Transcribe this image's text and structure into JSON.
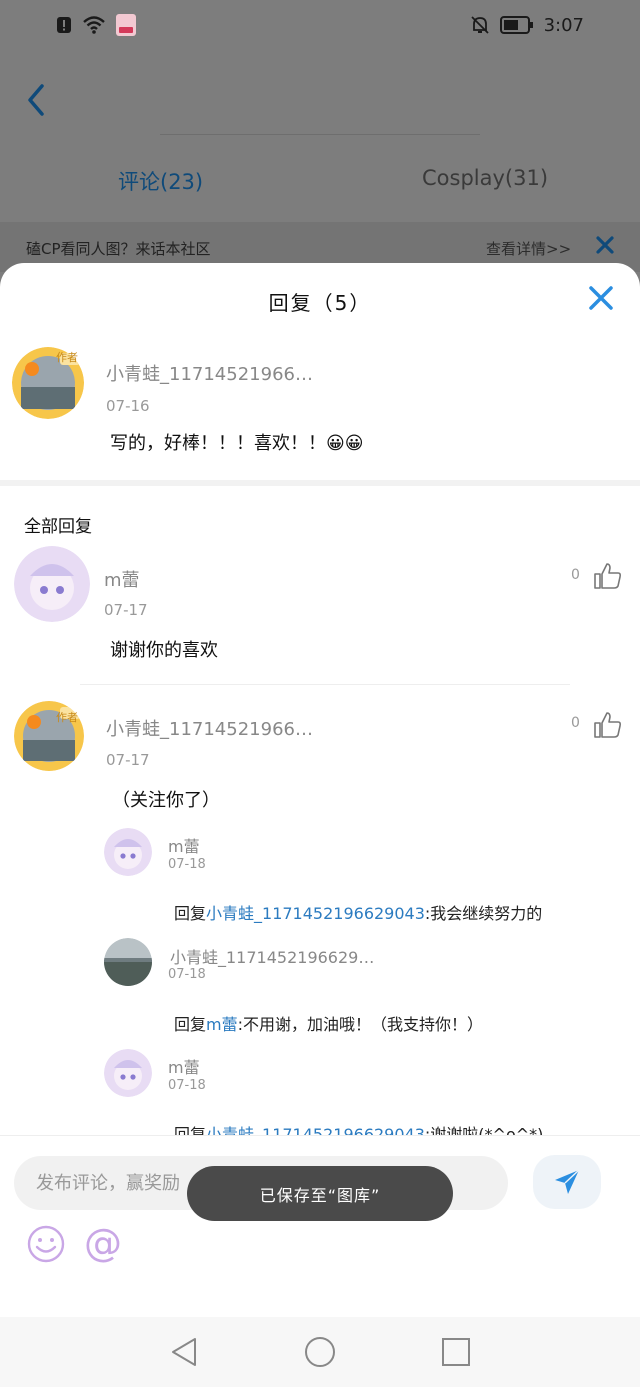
{
  "status_bar": {
    "time": "3:07",
    "icons": [
      "alert-icon",
      "wifi-icon",
      "app-badge-icon",
      "mute-icon",
      "battery-icon"
    ]
  },
  "background_page": {
    "tabs": [
      {
        "label": "评论(23)",
        "active": true
      },
      {
        "label": "Cosplay(31)",
        "active": false
      }
    ],
    "banner": {
      "text": "磕CP看同人图？来话本社区",
      "link": "查看详情>>"
    }
  },
  "sheet": {
    "title": "回复（5）",
    "root_comment": {
      "user": "小青蛙_11714521966…",
      "badge": "作者",
      "date": "07-16",
      "text": "写的，好棒！！！喜欢！！😀😀"
    },
    "section_title": "全部回复",
    "replies": [
      {
        "user": "m蕾",
        "date": "07-17",
        "text": "谢谢你的喜欢",
        "likes": "0"
      },
      {
        "user": "小青蛙_11714521966…",
        "badge": "作者",
        "date": "07-17",
        "text": "（关注你了）",
        "likes": "0",
        "sub_replies": [
          {
            "user": "m蕾",
            "date": "07-18",
            "prefix": "回复",
            "target": "小青蛙_1171452196629043",
            "text": ":我会继续努力的"
          },
          {
            "user": "小青蛙_1171452196629…",
            "date": "07-18",
            "prefix": "回复",
            "target": "m蕾",
            "text": ":不用谢，加油哦！（我支持你！）"
          },
          {
            "user": "m蕾",
            "date": "07-18",
            "prefix": "回复",
            "target": "小青蛙_1171452196629043",
            "text": ":谢谢啦(*^o^*)"
          }
        ]
      }
    ]
  },
  "input": {
    "placeholder": "发布评论，赢奖励"
  },
  "toast": "已保存至“图库”",
  "colors": {
    "accent": "#2b8ee0",
    "link": "#2b7bc0",
    "toast_bg": "#4a4a4a"
  }
}
